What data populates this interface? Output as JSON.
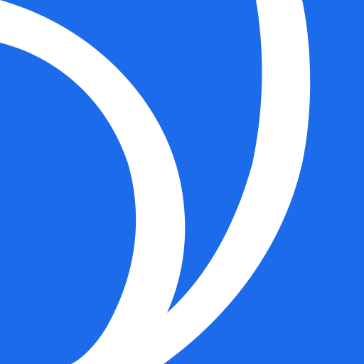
{
  "icon": {
    "name": "app-logo-icon",
    "background_color": "#1b6bea",
    "mark_color": "#ffffff"
  }
}
